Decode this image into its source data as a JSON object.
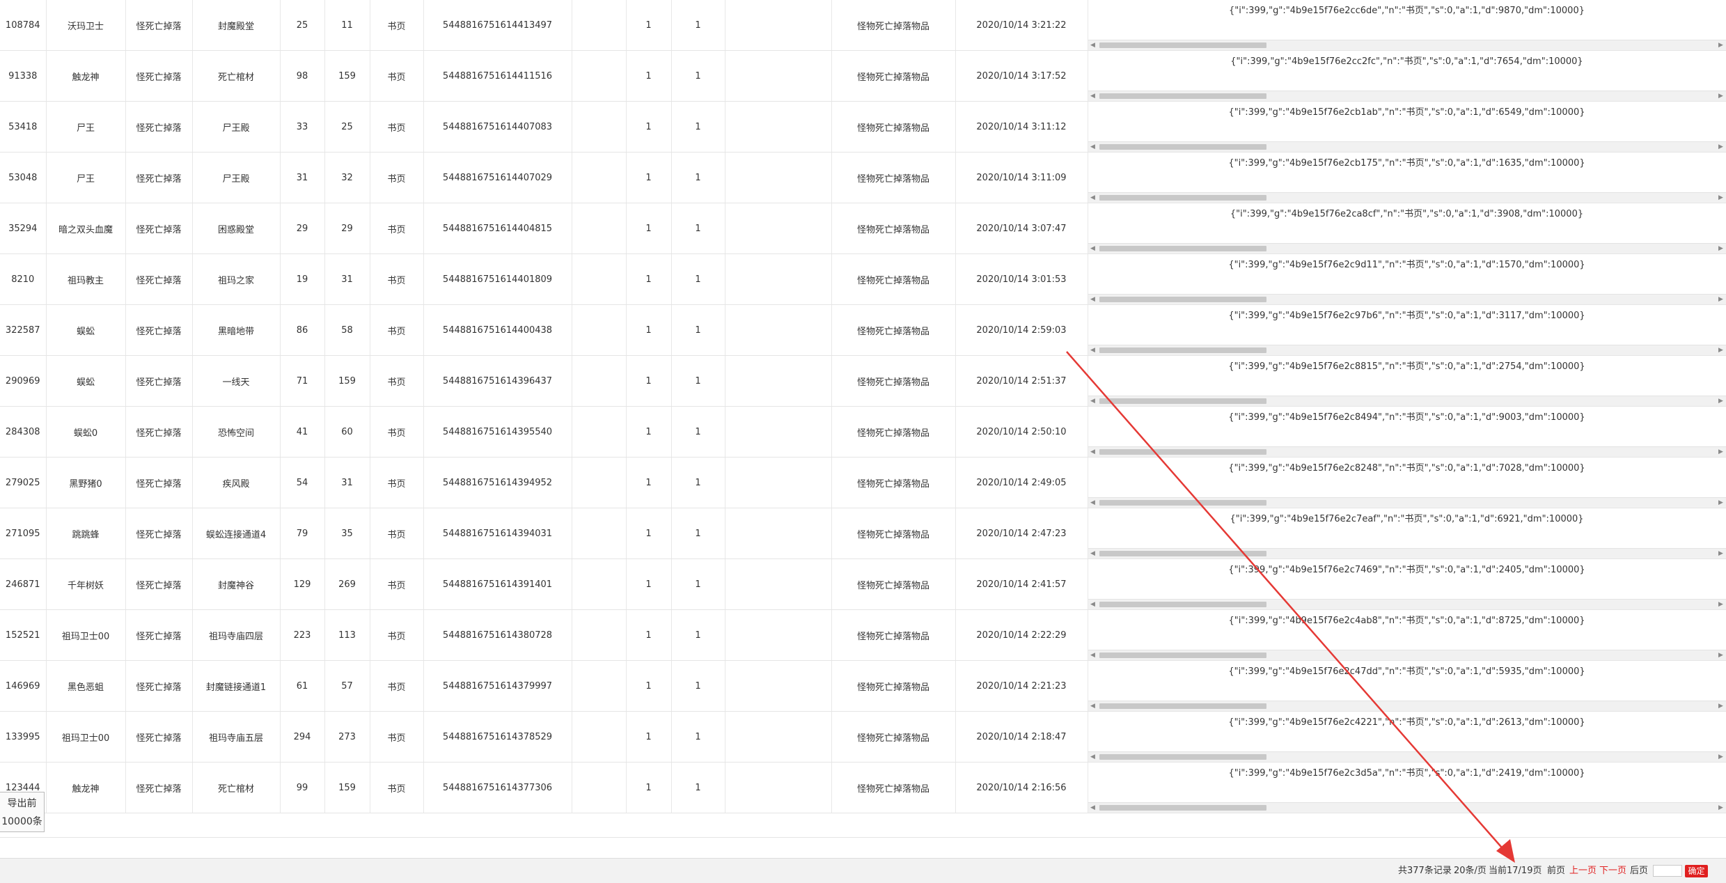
{
  "table": {
    "rows": [
      {
        "id": "108784",
        "monster": "沃玛卫士",
        "type": "怪死亡掉落",
        "map": "封魔殿堂",
        "x": "25",
        "y": "11",
        "item": "书页",
        "serial": "544881675161441349​7",
        "c1": "1",
        "c2": "1",
        "desc": "怪物死亡掉落物品",
        "time": "2020/10/14 3:21:22",
        "data": "{\"i\":399,\"g\":\"4b9e15f76e2cc6de\",\"n\":\"书页\",\"s\":0,\"a\":1,\"d\":9870,\"dm\":10000}"
      },
      {
        "id": "91338",
        "monster": "触龙神",
        "type": "怪死亡掉落",
        "map": "死亡棺材",
        "x": "98",
        "y": "159",
        "item": "书页",
        "serial": "5448816751614411516",
        "c1": "1",
        "c2": "1",
        "desc": "怪物死亡掉落物品",
        "time": "2020/10/14 3:17:52",
        "data": "{\"i\":399,\"g\":\"4b9e15f76e2cc2fc\",\"n\":\"书页\",\"s\":0,\"a\":1,\"d\":7654,\"dm\":10000}"
      },
      {
        "id": "53418",
        "monster": "尸王",
        "type": "怪死亡掉落",
        "map": "尸王殿",
        "x": "33",
        "y": "25",
        "item": "书页",
        "serial": "5448816751614407083",
        "c1": "1",
        "c2": "1",
        "desc": "怪物死亡掉落物品",
        "time": "2020/10/14 3:11:12",
        "data": "{\"i\":399,\"g\":\"4b9e15f76e2cb1ab\",\"n\":\"书页\",\"s\":0,\"a\":1,\"d\":6549,\"dm\":10000}"
      },
      {
        "id": "53048",
        "monster": "尸王",
        "type": "怪死亡掉落",
        "map": "尸王殿",
        "x": "31",
        "y": "32",
        "item": "书页",
        "serial": "5448816751614407029",
        "c1": "1",
        "c2": "1",
        "desc": "怪物死亡掉落物品",
        "time": "2020/10/14 3:11:09",
        "data": "{\"i\":399,\"g\":\"4b9e15f76e2cb175\",\"n\":\"书页\",\"s\":0,\"a\":1,\"d\":1635,\"dm\":10000}"
      },
      {
        "id": "35294",
        "monster": "暗之双头血魔",
        "type": "怪死亡掉落",
        "map": "困惑殿堂",
        "x": "29",
        "y": "29",
        "item": "书页",
        "serial": "5448816751614404815",
        "c1": "1",
        "c2": "1",
        "desc": "怪物死亡掉落物品",
        "time": "2020/10/14 3:07:47",
        "data": "{\"i\":399,\"g\":\"4b9e15f76e2ca8cf\",\"n\":\"书页\",\"s\":0,\"a\":1,\"d\":3908,\"dm\":10000}"
      },
      {
        "id": "8210",
        "monster": "祖玛教主",
        "type": "怪死亡掉落",
        "map": "祖玛之家",
        "x": "19",
        "y": "31",
        "item": "书页",
        "serial": "5448816751614401809",
        "c1": "1",
        "c2": "1",
        "desc": "怪物死亡掉落物品",
        "time": "2020/10/14 3:01:53",
        "data": "{\"i\":399,\"g\":\"4b9e15f76e2c9d11\",\"n\":\"书页\",\"s\":0,\"a\":1,\"d\":1570,\"dm\":10000}"
      },
      {
        "id": "322587",
        "monster": "蜈蚣",
        "type": "怪死亡掉落",
        "map": "黑暗地带",
        "x": "86",
        "y": "58",
        "item": "书页",
        "serial": "5448816751614400438",
        "c1": "1",
        "c2": "1",
        "desc": "怪物死亡掉落物品",
        "time": "2020/10/14 2:59:03",
        "data": "{\"i\":399,\"g\":\"4b9e15f76e2c97b6\",\"n\":\"书页\",\"s\":0,\"a\":1,\"d\":3117,\"dm\":10000}"
      },
      {
        "id": "290969",
        "monster": "蜈蚣",
        "type": "怪死亡掉落",
        "map": "一线天",
        "x": "71",
        "y": "159",
        "item": "书页",
        "serial": "5448816751614396437",
        "c1": "1",
        "c2": "1",
        "desc": "怪物死亡掉落物品",
        "time": "2020/10/14 2:51:37",
        "data": "{\"i\":399,\"g\":\"4b9e15f76e2c8815\",\"n\":\"书页\",\"s\":0,\"a\":1,\"d\":2754,\"dm\":10000}"
      },
      {
        "id": "284308",
        "monster": "蜈蚣0",
        "type": "怪死亡掉落",
        "map": "恐怖空间",
        "x": "41",
        "y": "60",
        "item": "书页",
        "serial": "5448816751614395540",
        "c1": "1",
        "c2": "1",
        "desc": "怪物死亡掉落物品",
        "time": "2020/10/14 2:50:10",
        "data": "{\"i\":399,\"g\":\"4b9e15f76e2c8494\",\"n\":\"书页\",\"s\":0,\"a\":1,\"d\":9003,\"dm\":10000}"
      },
      {
        "id": "279025",
        "monster": "黑野猪0",
        "type": "怪死亡掉落",
        "map": "疾风殿",
        "x": "54",
        "y": "31",
        "item": "书页",
        "serial": "5448816751614394952",
        "c1": "1",
        "c2": "1",
        "desc": "怪物死亡掉落物品",
        "time": "2020/10/14 2:49:05",
        "data": "{\"i\":399,\"g\":\"4b9e15f76e2c8248\",\"n\":\"书页\",\"s\":0,\"a\":1,\"d\":7028,\"dm\":10000}"
      },
      {
        "id": "271095",
        "monster": "跳跳蜂",
        "type": "怪死亡掉落",
        "map": "蜈蚣连接通道4",
        "x": "79",
        "y": "35",
        "item": "书页",
        "serial": "5448816751614394031",
        "c1": "1",
        "c2": "1",
        "desc": "怪物死亡掉落物品",
        "time": "2020/10/14 2:47:23",
        "data": "{\"i\":399,\"g\":\"4b9e15f76e2c7eaf\",\"n\":\"书页\",\"s\":0,\"a\":1,\"d\":6921,\"dm\":10000}"
      },
      {
        "id": "246871",
        "monster": "千年树妖",
        "type": "怪死亡掉落",
        "map": "封魔神谷",
        "x": "129",
        "y": "269",
        "item": "书页",
        "serial": "5448816751614391401",
        "c1": "1",
        "c2": "1",
        "desc": "怪物死亡掉落物品",
        "time": "2020/10/14 2:41:57",
        "data": "{\"i\":399,\"g\":\"4b9e15f76e2c7469\",\"n\":\"书页\",\"s\":0,\"a\":1,\"d\":2405,\"dm\":10000}"
      },
      {
        "id": "152521",
        "monster": "祖玛卫士00",
        "type": "怪死亡掉落",
        "map": "祖玛寺庙四层",
        "x": "223",
        "y": "113",
        "item": "书页",
        "serial": "5448816751614380728",
        "c1": "1",
        "c2": "1",
        "desc": "怪物死亡掉落物品",
        "time": "2020/10/14 2:22:29",
        "data": "{\"i\":399,\"g\":\"4b9e15f76e2c4ab8\",\"n\":\"书页\",\"s\":0,\"a\":1,\"d\":8725,\"dm\":10000}"
      },
      {
        "id": "146969",
        "monster": "黑色恶蛆",
        "type": "怪死亡掉落",
        "map": "封魔链接通道1",
        "x": "61",
        "y": "57",
        "item": "书页",
        "serial": "5448816751614379997",
        "c1": "1",
        "c2": "1",
        "desc": "怪物死亡掉落物品",
        "time": "2020/10/14 2:21:23",
        "data": "{\"i\":399,\"g\":\"4b9e15f76e2c47dd\",\"n\":\"书页\",\"s\":0,\"a\":1,\"d\":5935,\"dm\":10000}"
      },
      {
        "id": "133995",
        "monster": "祖玛卫士00",
        "type": "怪死亡掉落",
        "map": "祖玛寺庙五层",
        "x": "294",
        "y": "273",
        "item": "书页",
        "serial": "5448816751614378529",
        "c1": "1",
        "c2": "1",
        "desc": "怪物死亡掉落物品",
        "time": "2020/10/14 2:18:47",
        "data": "{\"i\":399,\"g\":\"4b9e15f76e2c4221\",\"n\":\"书页\",\"s\":0,\"a\":1,\"d\":2613,\"dm\":10000}"
      },
      {
        "id": "123444",
        "monster": "触龙神",
        "type": "怪死亡掉落",
        "map": "死亡棺材",
        "x": "99",
        "y": "159",
        "item": "书页",
        "serial": "5448816751614377306",
        "c1": "1",
        "c2": "1",
        "desc": "怪物死亡掉落物品",
        "time": "2020/10/14 2:16:56",
        "data": "{\"i\":399,\"g\":\"4b9e15f76e2c3d5a\",\"n\":\"书页\",\"s\":0,\"a\":1,\"d\":2419,\"dm\":10000}"
      }
    ]
  },
  "export": {
    "label": "导出前10000条"
  },
  "pager": {
    "total": "共377条记录",
    "per_page": "20条/页",
    "current": "当前17/19页",
    "first": "前页",
    "prev": "上一页",
    "next": "下一页",
    "last": "后页",
    "go": "确定",
    "jump_value": ""
  },
  "colors": {
    "accent_red": "#e02020",
    "annotation_arrow": "#e53935"
  }
}
